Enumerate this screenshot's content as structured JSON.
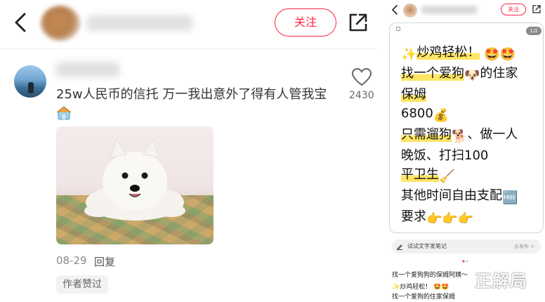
{
  "left": {
    "header": {
      "follow_label": "关注"
    },
    "comment": {
      "text": "25w人民币的信托 万一我出意外了得有人管我宝",
      "likes": "2430",
      "date": "08-29",
      "reply_label": "回复",
      "badge": "作者赞过"
    }
  },
  "right": {
    "header": {
      "follow_label": "关注"
    },
    "card": {
      "pager": "1/2",
      "lines": [
        "炒鸡轻松！",
        "找一个爱狗",
        "的住家",
        "保姆",
        "6800",
        "只需遛狗",
        "、做一人",
        "晚饭",
        "、打扫100",
        "平卫生",
        "其他时间自由支配",
        "要求"
      ]
    },
    "input": {
      "placeholder": "试试文字发笔记",
      "right_hint": "去发布 >"
    },
    "note": {
      "title": "找一个爱狗狗的保姆阿姨～",
      "line2": "✨炒鸡轻松！ 🤩🤩",
      "line3": "找一个爱狗的住家保姆"
    },
    "watermark": "正解局"
  },
  "colors": {
    "accent": "#ff2442",
    "highlight": "#ffe564"
  },
  "icons": {
    "back": "chevron-left-icon",
    "share": "share-icon",
    "like": "heart-icon"
  }
}
